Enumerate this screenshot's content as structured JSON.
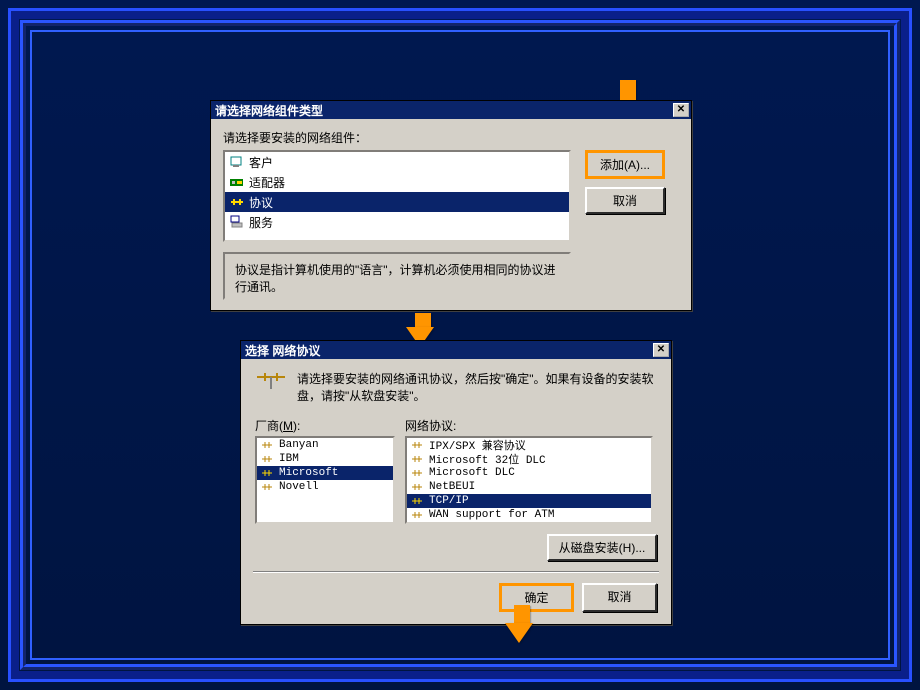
{
  "dialog1": {
    "title": "请选择网络组件类型",
    "prompt": "请选择要安装的网络组件：",
    "items": [
      {
        "label": "客户"
      },
      {
        "label": "适配器"
      },
      {
        "label": "协议"
      },
      {
        "label": "服务"
      }
    ],
    "selected_index": 2,
    "add_button": "添加(A)...",
    "cancel_button": "取消",
    "description": "协议是指计算机使用的\"语言\"，计算机必须使用相同的协议进行通讯。"
  },
  "dialog2": {
    "title": "选择 网络协议",
    "instruction": "请选择要安装的网络通讯协议，然后按\"确定\"。如果有设备的安装软盘，请按\"从软盘安装\"。",
    "vendor_label": "厂商(M):",
    "protocol_label": "网络协议:",
    "vendors": [
      "Banyan",
      "IBM",
      "Microsoft",
      "Novell"
    ],
    "vendor_selected_index": 2,
    "protocols": [
      "IPX/SPX 兼容协议",
      "Microsoft 32位 DLC",
      "Microsoft DLC",
      "NetBEUI",
      "TCP/IP",
      "WAN support for ATM"
    ],
    "protocol_selected_index": 4,
    "disk_button": "从磁盘安装(H)...",
    "ok_button": "确定",
    "cancel_button": "取消"
  }
}
